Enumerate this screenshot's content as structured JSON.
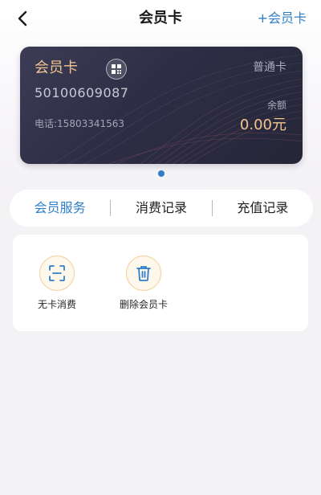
{
  "header": {
    "title": "会员卡",
    "add_card_label": "+会员卡",
    "back_icon": "chevron-left-icon"
  },
  "card": {
    "name": "会员卡",
    "type": "普通卡",
    "number": "50100609087",
    "phone": "电话:15803341563",
    "balance_label": "余额",
    "balance_value": "0.00元",
    "qr_icon": "qr-code-icon"
  },
  "pager": {
    "current": 1,
    "total": 1
  },
  "tabs": [
    {
      "label": "会员服务",
      "active": true
    },
    {
      "label": "消费记录",
      "active": false
    },
    {
      "label": "充值记录",
      "active": false
    }
  ],
  "services": [
    {
      "label": "无卡消费",
      "icon": "scan-icon"
    },
    {
      "label": "删除会员卡",
      "icon": "trash-icon"
    }
  ],
  "colors": {
    "accent": "#2f7fc8",
    "gold": "#f1c58f",
    "card_bg": "#2d2d45",
    "icon_ring": "#f0cf95"
  }
}
